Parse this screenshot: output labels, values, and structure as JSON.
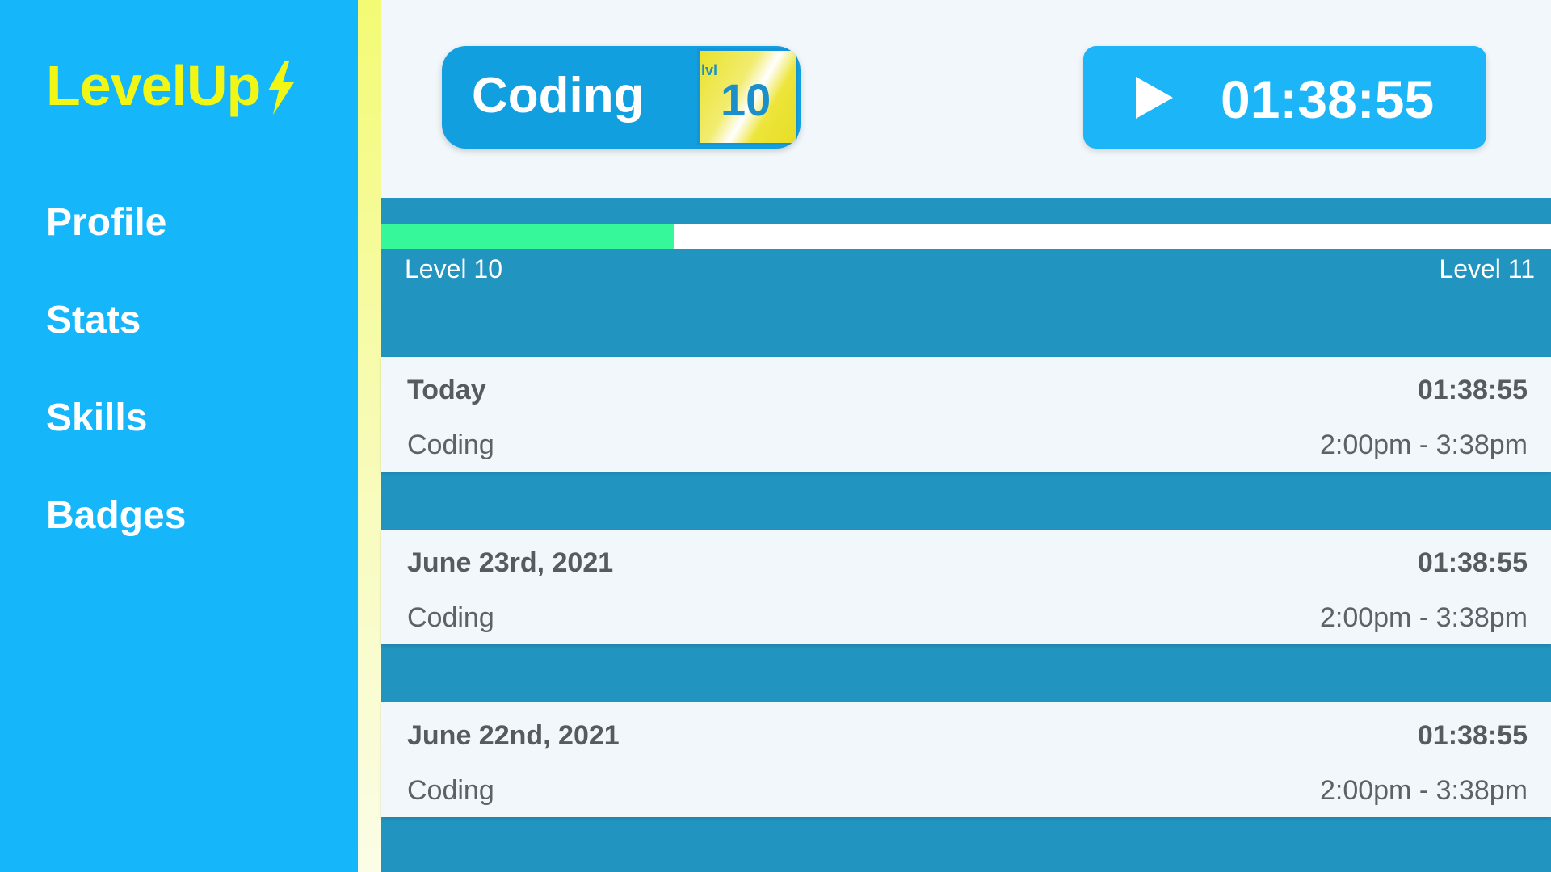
{
  "app": {
    "logo": "LevelUp"
  },
  "sidebar": {
    "items": [
      {
        "label": "Profile"
      },
      {
        "label": "Stats"
      },
      {
        "label": "Skills"
      },
      {
        "label": "Badges"
      }
    ]
  },
  "skill": {
    "name": "Coding",
    "level_label": "lvl",
    "level": "10"
  },
  "timer": {
    "icon": "play-icon",
    "time": "01:38:55"
  },
  "progress": {
    "fraction": 0.25,
    "from_label": "Level 10",
    "to_label": "Level 11"
  },
  "entries": [
    {
      "date": "Today",
      "duration": "01:38:55",
      "activity": "Coding",
      "range": "2:00pm - 3:38pm"
    },
    {
      "date": "June 23rd, 2021",
      "duration": "01:38:55",
      "activity": "Coding",
      "range": "2:00pm - 3:38pm"
    },
    {
      "date": "June 22nd, 2021",
      "duration": "01:38:55",
      "activity": "Coding",
      "range": "2:00pm - 3:38pm"
    }
  ],
  "colors": {
    "sidebar": "#16b6fb",
    "logo": "#f1f614",
    "panel": "#2194bf",
    "progress_fill": "#36f79a",
    "level_badge": "#e9e22a"
  }
}
